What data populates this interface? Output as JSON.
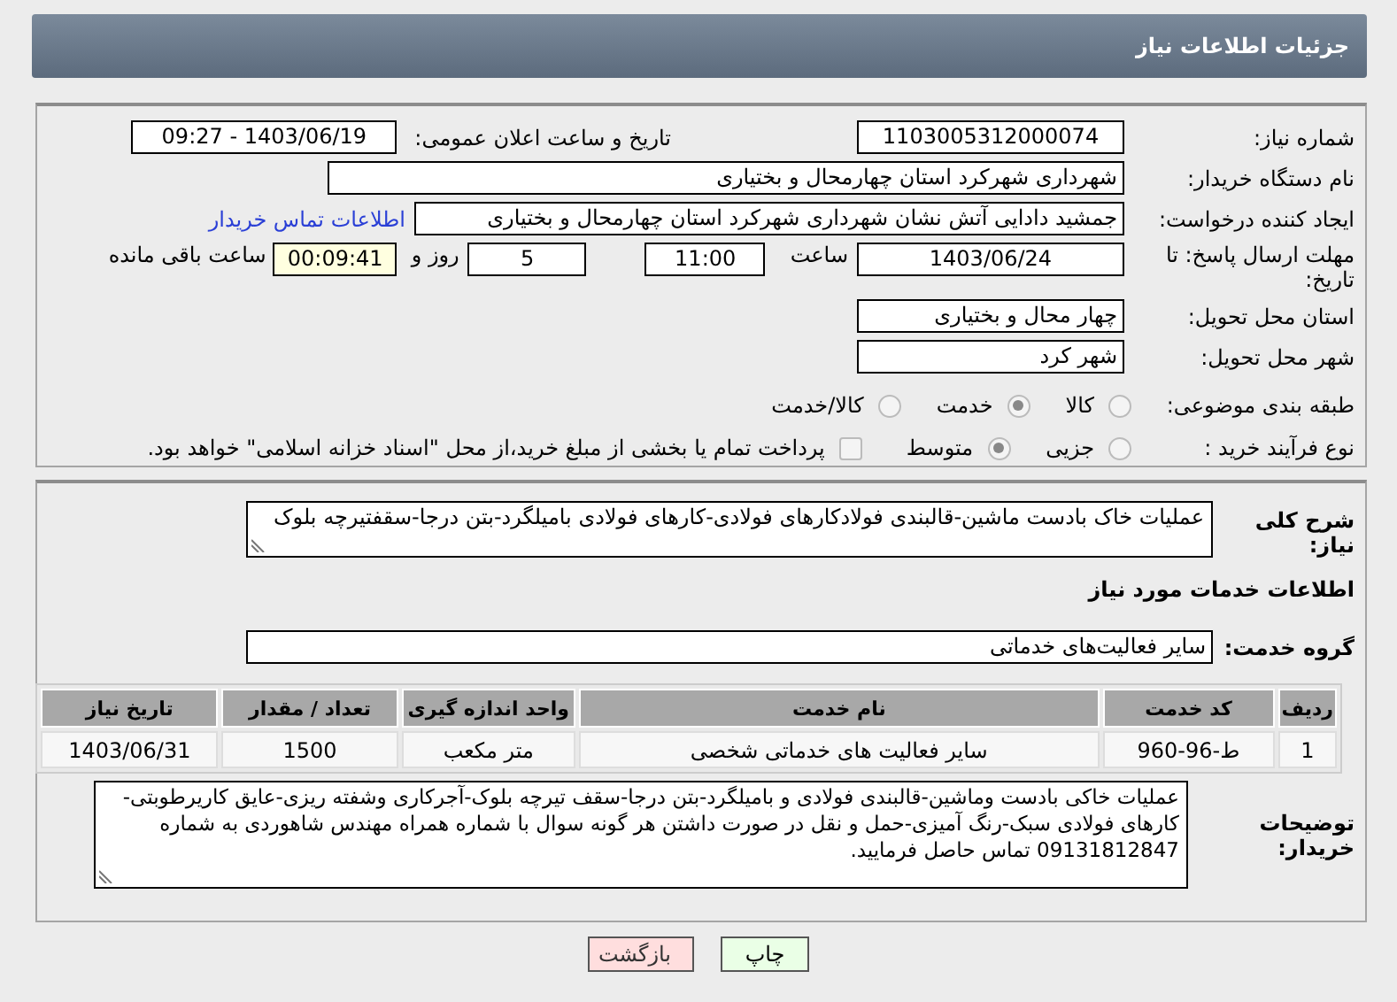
{
  "header": {
    "title": "جزئیات اطلاعات نیاز"
  },
  "need_number": {
    "label": "شماره نیاز:",
    "value": "1103005312000074"
  },
  "announce_date": {
    "label": "تاریخ و ساعت اعلان عمومی:",
    "value": "1403/06/19 - 09:27"
  },
  "buyer_org": {
    "label": "نام دستگاه خریدار:",
    "value": "شهرداری شهرکرد استان چهارمحال و بختیاری"
  },
  "requester": {
    "label": "ایجاد کننده درخواست:",
    "value": "جمشید دادایی آتش نشان شهرداری شهرکرد استان چهارمحال و بختیاری",
    "contact_link": "اطلاعات تماس خریدار"
  },
  "deadline": {
    "label": "مهلت ارسال پاسخ: تا تاریخ:",
    "date": "1403/06/24",
    "time_label": "ساعت",
    "time": "11:00",
    "days": "5",
    "days_label": "روز و",
    "remaining": "00:09:41",
    "remaining_label": "ساعت باقی مانده"
  },
  "province": {
    "label": "استان محل تحویل:",
    "value": "چهار محال و بختیاری"
  },
  "city": {
    "label": "شهر محل تحویل:",
    "value": "شهر کرد"
  },
  "category": {
    "label": "طبقه بندی موضوعی:",
    "options": [
      {
        "label": "کالا",
        "selected": false
      },
      {
        "label": "خدمت",
        "selected": true
      },
      {
        "label": "کالا/خدمت",
        "selected": false
      }
    ]
  },
  "process": {
    "label": "نوع فرآیند خرید :",
    "options": [
      {
        "label": "جزیی",
        "selected": false
      },
      {
        "label": "متوسط",
        "selected": true
      }
    ],
    "payment": {
      "checked": false,
      "label": "پرداخت تمام یا بخشی از مبلغ خرید،از محل \"اسناد خزانه اسلامی\" خواهد بود."
    }
  },
  "description": {
    "label": "شرح کلی نیاز:",
    "value": "عملیات خاک بادست ماشین-قالبندی فولادکارهای فولادی-کارهای فولادی بامیلگرد-بتن درجا-سقفتیرچه بلوک"
  },
  "services_heading": "اطلاعات خدمات مورد نیاز",
  "service_group": {
    "label": "گروه خدمت:",
    "value": "سایر فعالیت‌های خدماتی"
  },
  "table": {
    "columns": [
      "ردیف",
      "کد خدمت",
      "نام خدمت",
      "واحد اندازه گیری",
      "تعداد / مقدار",
      "تاریخ نیاز"
    ],
    "rows": [
      [
        "1",
        "ط-96-960",
        "سایر فعالیت های خدماتی شخصی",
        "متر مکعب",
        "1500",
        "1403/06/31"
      ]
    ]
  },
  "buyer_notes": {
    "label": "توضیحات خریدار:",
    "value": "عملیات خاکی بادست وماشین-قالبندی فولادی و بامیلگرد-بتن درجا-سقف تیرچه بلوک-آجرکاری وشفته ریزی-عایق کاریرطوبتی-کارهای فولادی سبک-رنگ آمیزی-حمل و نقل در صورت داشتن هر گونه سوال با شماره همراه مهندس شاهوردی به شماره 09131812847 تماس حاصل فرمایید."
  },
  "buttons": [
    {
      "label": "چاپ",
      "kind": "print"
    },
    {
      "label": "بازگشت",
      "kind": "back"
    }
  ]
}
